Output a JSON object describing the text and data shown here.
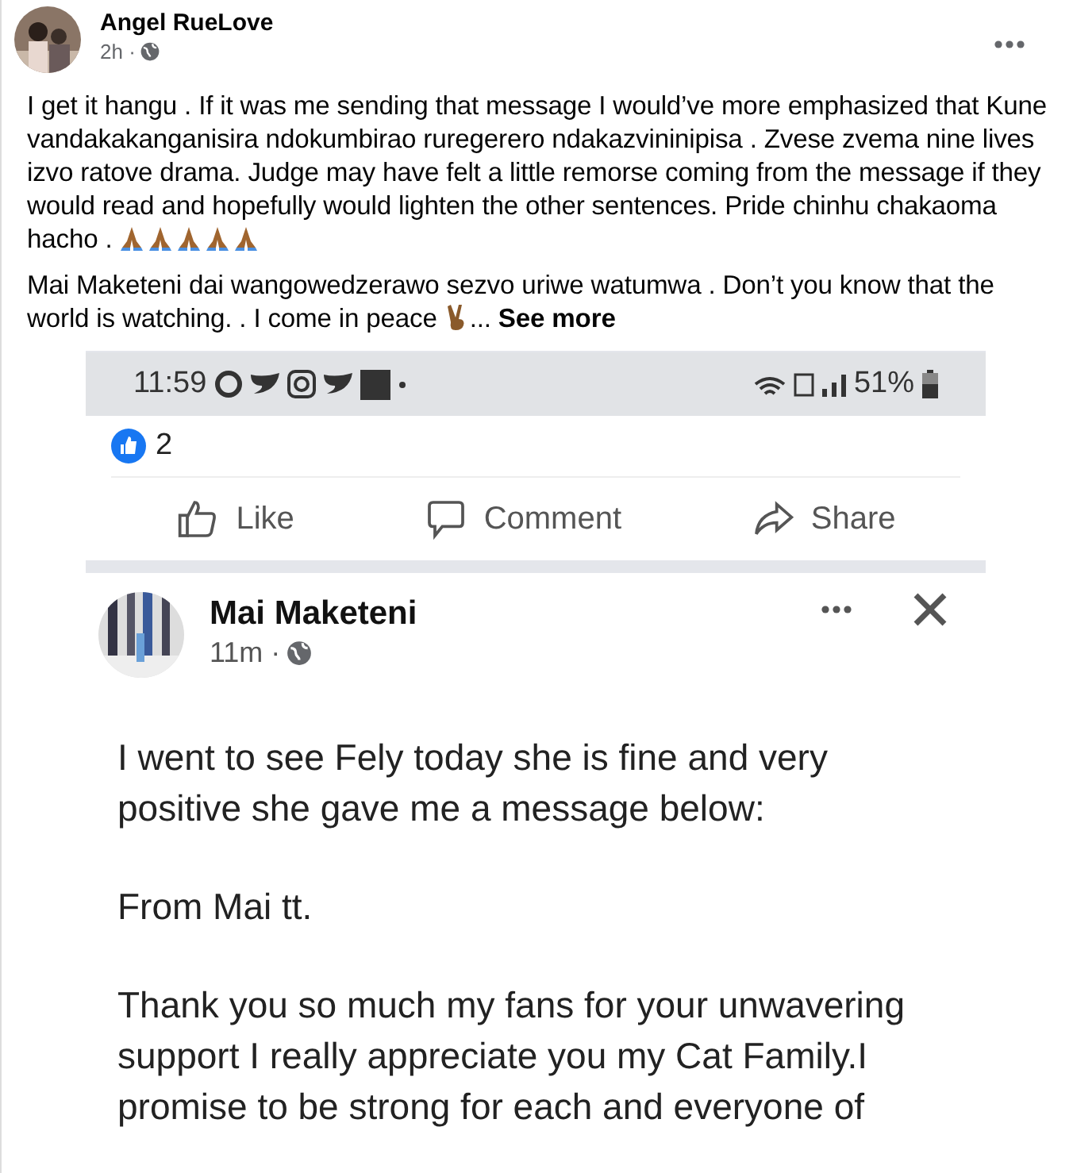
{
  "post": {
    "author": "Angel RueLove",
    "time": "2h ·",
    "paragraphs": [
      {
        "text": "I  get it hangu . If it was me sending that message I would’ve more emphasized that Kune vandakakanganisira ndokumbirao ruregerero ndakazvininipisa . Zvese zvema nine lives izvo ratove drama. Judge may have felt a little remorse coming from the message if they would read and hopefully would lighten the other sentences. Pride chinhu chakaoma hacho .",
        "emojis": [
          {
            "kind": "pray"
          },
          {
            "kind": "pray"
          },
          {
            "kind": "pray"
          },
          {
            "kind": "pray"
          },
          {
            "kind": "pray"
          }
        ]
      },
      {
        "text": "Mai Maketeni dai wangowedzerawo sezvo uriwe watumwa . Don’t you know that the world is watching. .  I come in peace",
        "emojis": [
          {
            "kind": "victory"
          }
        ],
        "tail": "...",
        "see_more": "See more"
      }
    ]
  },
  "phone": {
    "status_time": "11:59",
    "battery": "51%",
    "like_count": "2",
    "actions": [
      {
        "kind": "like",
        "label": "Like"
      },
      {
        "kind": "comment",
        "label": "Comment"
      },
      {
        "kind": "share",
        "label": "Share"
      }
    ],
    "shared_post": {
      "author": "Mai Maketeni",
      "time": "11m ·",
      "paragraphs": [
        "I went to see Fely today she is fine and very positive she gave me a message below:",
        "From Mai tt.",
        "Thank you so much my fans for your unwavering support I really appreciate you my Cat Family.I promise to be strong for each and everyone of"
      ]
    }
  }
}
